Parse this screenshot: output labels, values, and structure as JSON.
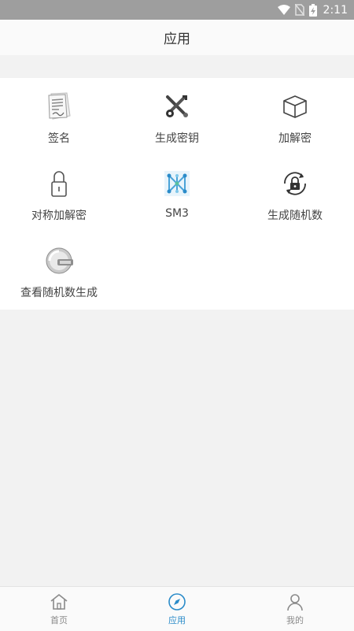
{
  "status_bar": {
    "time": "2:11"
  },
  "header": {
    "title": "应用"
  },
  "apps": [
    {
      "label": "签名",
      "icon": "signature-document-icon"
    },
    {
      "label": "生成密钥",
      "icon": "key-tools-icon"
    },
    {
      "label": "加解密",
      "icon": "box-icon"
    },
    {
      "label": "对称加解密",
      "icon": "padlock-icon"
    },
    {
      "label": "SM3",
      "icon": "hash-network-icon"
    },
    {
      "label": "生成随机数",
      "icon": "random-lock-icon"
    },
    {
      "label": "查看随机数生成",
      "icon": "disk-icon"
    }
  ],
  "tabs": [
    {
      "label": "首页",
      "icon": "home-icon",
      "active": false
    },
    {
      "label": "应用",
      "icon": "compass-icon",
      "active": true
    },
    {
      "label": "我的",
      "icon": "user-icon",
      "active": false
    }
  ],
  "colors": {
    "accent": "#2a8bc9",
    "status_bar": "#9e9e9e",
    "background": "#f2f2f2"
  }
}
